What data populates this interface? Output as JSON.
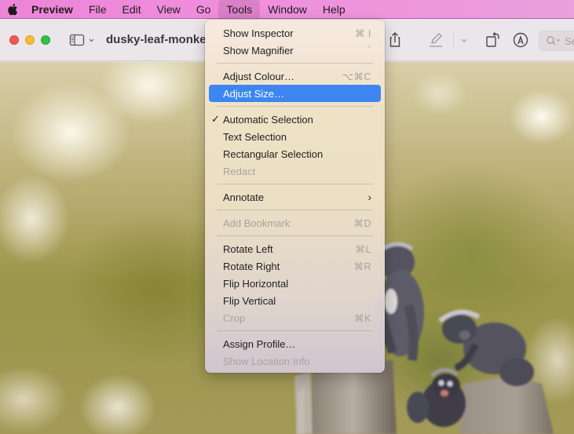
{
  "menubar": {
    "apple_icon": "apple-logo",
    "items": [
      {
        "label": "Preview"
      },
      {
        "label": "File"
      },
      {
        "label": "Edit"
      },
      {
        "label": "View"
      },
      {
        "label": "Go"
      },
      {
        "label": "Tools"
      },
      {
        "label": "Window"
      },
      {
        "label": "Help"
      }
    ],
    "active": "Tools"
  },
  "window": {
    "title": "dusky-leaf-monke",
    "toolbar": {
      "sidebar_icon": "sidebar-toggle",
      "share_icon": "share",
      "highlight_icon": "pen-markup",
      "rotate_icon": "rotate-left",
      "markup_icon": "markup-toolbar",
      "search_placeholder": "Se"
    }
  },
  "tools_menu": {
    "items": [
      {
        "label": "Show Inspector",
        "shortcut": "⌘ I",
        "enabled": true
      },
      {
        "label": "Show Magnifier",
        "shortcut": "`",
        "enabled": true
      },
      {
        "separator": true
      },
      {
        "label": "Adjust Colour…",
        "shortcut": "⌥⌘C",
        "enabled": true
      },
      {
        "label": "Adjust Size…",
        "shortcut": "",
        "enabled": true,
        "highlighted": true
      },
      {
        "separator": true
      },
      {
        "label": "Automatic Selection",
        "shortcut": "",
        "enabled": true,
        "checked": true
      },
      {
        "label": "Text Selection",
        "shortcut": "",
        "enabled": true
      },
      {
        "label": "Rectangular Selection",
        "shortcut": "",
        "enabled": true
      },
      {
        "label": "Redact",
        "shortcut": "",
        "enabled": false
      },
      {
        "separator": true
      },
      {
        "label": "Annotate",
        "shortcut": "",
        "enabled": true,
        "submenu": true
      },
      {
        "separator": true
      },
      {
        "label": "Add Bookmark",
        "shortcut": "⌘D",
        "enabled": false
      },
      {
        "separator": true
      },
      {
        "label": "Rotate Left",
        "shortcut": "⌘L",
        "enabled": true
      },
      {
        "label": "Rotate Right",
        "shortcut": "⌘R",
        "enabled": true
      },
      {
        "label": "Flip Horizontal",
        "shortcut": "",
        "enabled": true
      },
      {
        "label": "Flip Vertical",
        "shortcut": "",
        "enabled": true
      },
      {
        "label": "Crop",
        "shortcut": "⌘K",
        "enabled": false
      },
      {
        "separator": true
      },
      {
        "label": "Assign Profile…",
        "shortcut": "",
        "enabled": true
      },
      {
        "label": "Show Location Info",
        "shortcut": "",
        "enabled": false
      }
    ],
    "checkmark": "✓",
    "submenu_arrow": "›"
  },
  "image": {
    "subject": "dusky leaf monkeys on tree stumps"
  }
}
